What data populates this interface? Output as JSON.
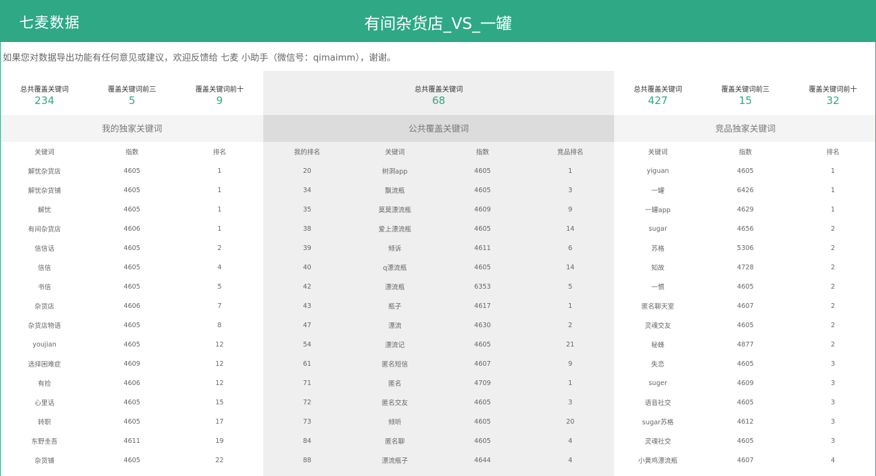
{
  "header": {
    "brand": "七麦数据",
    "title": "有间杂货店_VS_一罐"
  },
  "notice": "如果您对数据导出功能有任何意见或建议，欢迎反馈给 七麦 小助手（微信号：qimaimm），谢谢。",
  "left": {
    "stats": [
      {
        "label": "总共覆盖关键词",
        "value": "234"
      },
      {
        "label": "覆盖关键词前三",
        "value": "5"
      },
      {
        "label": "覆盖关键词前十",
        "value": "9"
      }
    ],
    "section_title": "我的独家关键词",
    "headers": [
      "关键词",
      "指数",
      "排名"
    ],
    "rows": [
      [
        "解忧杂货店",
        "4605",
        "1"
      ],
      [
        "解忧杂货铺",
        "4605",
        "1"
      ],
      [
        "解忧",
        "4605",
        "1"
      ],
      [
        "有间杂货店",
        "4606",
        "1"
      ],
      [
        "信信话",
        "4605",
        "2"
      ],
      [
        "信信",
        "4605",
        "4"
      ],
      [
        "书信",
        "4605",
        "5"
      ],
      [
        "杂货店",
        "4606",
        "7"
      ],
      [
        "杂货店物语",
        "4605",
        "8"
      ],
      [
        "youjian",
        "4605",
        "12"
      ],
      [
        "选择困难症",
        "4609",
        "12"
      ],
      [
        "有捡",
        "4606",
        "12"
      ],
      [
        "心里话",
        "4605",
        "15"
      ],
      [
        "转职",
        "4605",
        "17"
      ],
      [
        "东野圭吾",
        "4611",
        "19"
      ],
      [
        "杂货铺",
        "4605",
        "22"
      ]
    ]
  },
  "mid": {
    "stats": [
      {
        "label": "总共覆盖关键词",
        "value": "68"
      }
    ],
    "section_title": "公共覆盖关键词",
    "headers": [
      "我的排名",
      "关键词",
      "指数",
      "竞品排名"
    ],
    "rows": [
      [
        "20",
        "树洞app",
        "4605",
        "1"
      ],
      [
        "34",
        "飘流瓶",
        "4605",
        "3"
      ],
      [
        "35",
        "莫莫漂流瓶",
        "4609",
        "9"
      ],
      [
        "38",
        "爱上漂流瓶",
        "4605",
        "14"
      ],
      [
        "39",
        "倾诉",
        "4611",
        "6"
      ],
      [
        "40",
        "q漂流瓶",
        "4605",
        "14"
      ],
      [
        "42",
        "漂流瓶",
        "6353",
        "5"
      ],
      [
        "43",
        "瓶子",
        "4617",
        "1"
      ],
      [
        "47",
        "漂流",
        "4630",
        "2"
      ],
      [
        "54",
        "漂流记",
        "4605",
        "21"
      ],
      [
        "61",
        "匿名短信",
        "4607",
        "9"
      ],
      [
        "71",
        "匿名",
        "4709",
        "1"
      ],
      [
        "72",
        "匿名交友",
        "4605",
        "3"
      ],
      [
        "73",
        "倾听",
        "4605",
        "20"
      ],
      [
        "84",
        "匿名聊",
        "4605",
        "4"
      ],
      [
        "88",
        "漂流瓶子",
        "4644",
        "4"
      ]
    ]
  },
  "right": {
    "stats": [
      {
        "label": "总共覆盖关键词",
        "value": "427"
      },
      {
        "label": "覆盖关键词前三",
        "value": "15"
      },
      {
        "label": "覆盖关键词前十",
        "value": "32"
      }
    ],
    "section_title": "竞品独家关键词",
    "headers": [
      "关键词",
      "指数",
      "排名"
    ],
    "rows": [
      [
        "yiguan",
        "4605",
        "1"
      ],
      [
        "一罐",
        "6426",
        "1"
      ],
      [
        "一罐app",
        "4629",
        "1"
      ],
      [
        "sugar",
        "4656",
        "2"
      ],
      [
        "苏格",
        "5306",
        "2"
      ],
      [
        "知故",
        "4728",
        "2"
      ],
      [
        "一惯",
        "4605",
        "2"
      ],
      [
        "匿名聊天室",
        "4607",
        "2"
      ],
      [
        "灵魂交友",
        "4605",
        "2"
      ],
      [
        "秘蜂",
        "4877",
        "2"
      ],
      [
        "失恋",
        "4605",
        "3"
      ],
      [
        "suger",
        "4609",
        "3"
      ],
      [
        "语音社交",
        "4605",
        "3"
      ],
      [
        "sugar苏格",
        "4612",
        "3"
      ],
      [
        "灵魂社交",
        "4605",
        "3"
      ],
      [
        "小黄鸡漂流瓶",
        "4607",
        "4"
      ]
    ]
  }
}
